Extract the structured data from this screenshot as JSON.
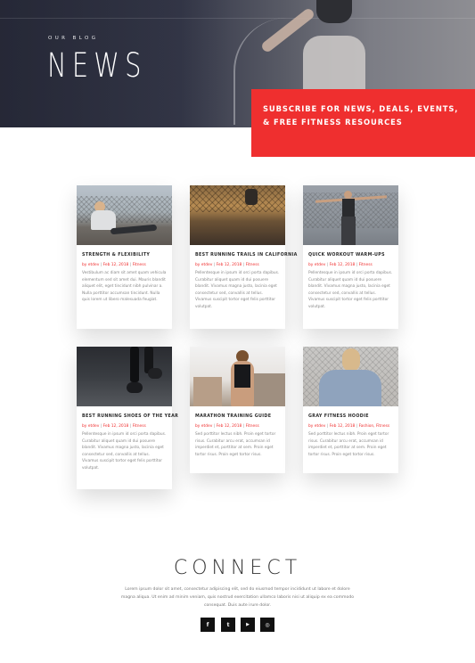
{
  "hero": {
    "eyebrow": "OUR BLOG",
    "title": "NEWS",
    "subscribe_text": "SUBSCRIBE FOR NEWS, DEALS, EVENTS, & FREE FITNESS RESOURCES"
  },
  "posts": [
    {
      "title": "STRENGTH & FLEXIBILITY",
      "author": "by etdev",
      "date": "Feb 12, 2018",
      "category": "Fitness",
      "excerpt": "Vestibulum ac diam sit amet quam vehicula elementum sed sit amet dui. Mauris blandit aliquet elit, eget tincidunt nibh pulvinar a. Nulla porttitor accumsan tincidunt. Nulla quis lorem ut libero malesuada feugiat."
    },
    {
      "title": "BEST RUNNING TRAILS IN CALIFORNIA",
      "author": "by etdev",
      "date": "Feb 12, 2018",
      "category": "Fitness",
      "excerpt": "Pellentesque in ipsum id orci porta dapibus. Curabitur aliquet quam id dui posuere blandit. Vivamus magna justo, lacinia eget consectetur sed, convallis at tellus. Vivamus suscipit tortor eget felis porttitor volutpat."
    },
    {
      "title": "QUICK WORKOUT WARM-UPS",
      "author": "by etdev",
      "date": "Feb 12, 2018",
      "category": "Fitness",
      "excerpt": "Pellentesque in ipsum id orci porta dapibus. Curabitur aliquet quam id dui posuere blandit. Vivamus magna justo, lacinia eget consectetur sed, convallis at tellus. Vivamus suscipit tortor eget felis porttitor volutpat."
    },
    {
      "title": "BEST RUNNING SHOES OF THE YEAR",
      "author": "by etdev",
      "date": "Feb 12, 2018",
      "category": "Fitness",
      "excerpt": "Pellentesque in ipsum id orci porta dapibus. Curabitur aliquet quam id dui posuere blandit. Vivamus magna justo, lacinia eget consectetur sed, convallis at tellus. Vivamus suscipit tortor eget felis porttitor volutpat."
    },
    {
      "title": "MARATHON TRAINING GUIDE",
      "author": "by etdev",
      "date": "Feb 12, 2018",
      "category": "Fitness",
      "excerpt": "Sed porttitor lectus nibh. Proin eget tortor risus. Curabitur arcu erat, accumsan id imperdiet et, porttitor at sem. Proin eget tortor risus. Proin eget tortor risus."
    },
    {
      "title": "GRAY FITNESS HOODIE",
      "author": "by etdev",
      "date": "Feb 12, 2018",
      "category": "Fashion, Fitness",
      "excerpt": "Sed porttitor lectus nibh. Proin eget tortor risus. Curabitur arcu erat, accumsan id imperdiet et, porttitor at sem. Proin eget tortor risus. Proin eget tortor risus."
    }
  ],
  "connect": {
    "title": "CONNECT",
    "text": "Lorem ipsum dolor sit amet, consectetur adipiscing elit, sed do eiusmod tempor incididunt ut labore et dolore magna aliqua. Ut enim ad minim veniam, quis nostrud exercitation ullamco laboris nisi ut aliquip ex ea commodo consequat. Duis aute irure dolor.",
    "social": [
      {
        "icon": "facebook-icon",
        "glyph": "f"
      },
      {
        "icon": "twitter-icon",
        "glyph": "t"
      },
      {
        "icon": "youtube-icon",
        "glyph": "▶"
      },
      {
        "icon": "instagram-icon",
        "glyph": "◎"
      }
    ]
  },
  "colors": {
    "accent": "#ef2f2f",
    "hero_dark": "#2f3242",
    "social_bg": "#111111"
  }
}
